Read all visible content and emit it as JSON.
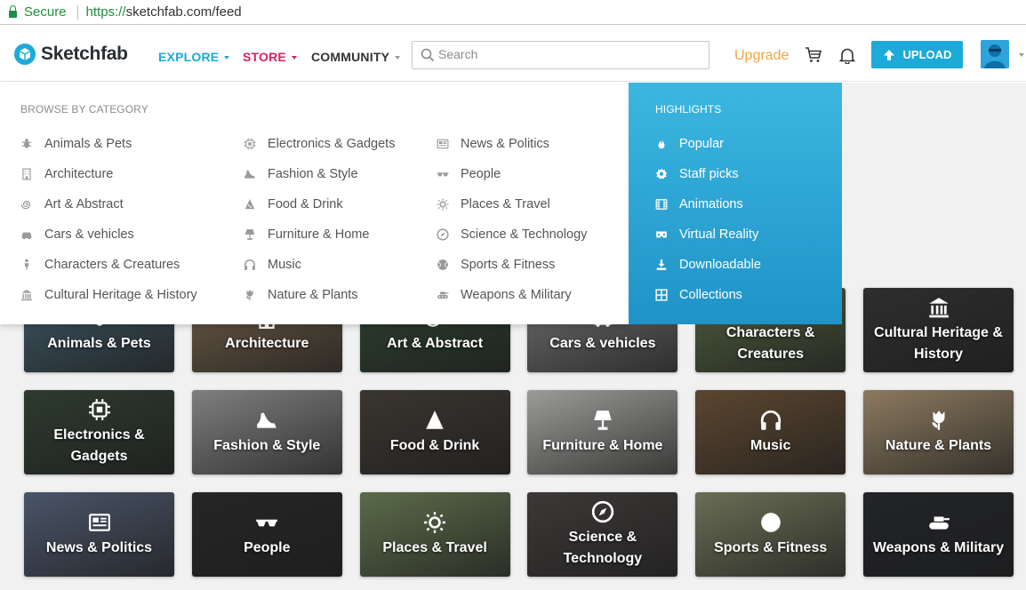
{
  "browser": {
    "secure_label": "Secure",
    "url_scheme": "https://",
    "url_rest": "sketchfab.com/feed"
  },
  "header": {
    "logo_text": "Sketchfab",
    "nav": [
      {
        "label": "EXPLORE",
        "color": "#1caad9"
      },
      {
        "label": "STORE",
        "color": "#d6245b"
      },
      {
        "label": "COMMUNITY",
        "color": "#333333"
      }
    ],
    "search_placeholder": "Search",
    "upgrade_label": "Upgrade",
    "upload_label": "UPLOAD"
  },
  "menu": {
    "heading": "BROWSE BY CATEGORY",
    "columns": [
      [
        {
          "label": "Animals & Pets",
          "icon": "bug-icon"
        },
        {
          "label": "Architecture",
          "icon": "building-icon"
        },
        {
          "label": "Art & Abstract",
          "icon": "spiral-icon"
        },
        {
          "label": "Cars & vehicles",
          "icon": "car-icon"
        },
        {
          "label": "Characters & Creatures",
          "icon": "figure-icon"
        },
        {
          "label": "Cultural Heritage & History",
          "icon": "temple-icon"
        }
      ],
      [
        {
          "label": "Electronics & Gadgets",
          "icon": "chip-icon"
        },
        {
          "label": "Fashion & Style",
          "icon": "heel-icon"
        },
        {
          "label": "Food & Drink",
          "icon": "pizza-icon"
        },
        {
          "label": "Furniture & Home",
          "icon": "lamp-icon"
        },
        {
          "label": "Music",
          "icon": "headphones-icon"
        },
        {
          "label": "Nature & Plants",
          "icon": "tulip-icon"
        }
      ],
      [
        {
          "label": "News & Politics",
          "icon": "newspaper-icon"
        },
        {
          "label": "People",
          "icon": "glasses-icon"
        },
        {
          "label": "Places & Travel",
          "icon": "sun-icon"
        },
        {
          "label": "Science & Technology",
          "icon": "compass-icon"
        },
        {
          "label": "Sports & Fitness",
          "icon": "ball-icon"
        },
        {
          "label": "Weapons & Military",
          "icon": "tank-icon"
        }
      ]
    ]
  },
  "highlights": {
    "heading": "HIGHLIGHTS",
    "items": [
      {
        "label": "Popular",
        "icon": "flame-icon"
      },
      {
        "label": "Staff picks",
        "icon": "badge-icon"
      },
      {
        "label": "Animations",
        "icon": "film-icon"
      },
      {
        "label": "Virtual Reality",
        "icon": "vr-icon"
      },
      {
        "label": "Downloadable",
        "icon": "download-icon"
      },
      {
        "label": "Collections",
        "icon": "grid-icon"
      }
    ]
  },
  "tiles": [
    {
      "label": "Animals & Pets",
      "bg": "#3d5560",
      "icon": "bug-icon"
    },
    {
      "label": "Architecture",
      "bg": "#6a5a45",
      "icon": "building-icon"
    },
    {
      "label": "Art & Abstract",
      "bg": "#2d4030",
      "icon": "spiral-icon"
    },
    {
      "label": "Cars & vehicles",
      "bg": "#6c6c6c",
      "icon": "car-icon"
    },
    {
      "label": "Characters & Creatures",
      "bg": "#4c5a3c",
      "icon": "figure-icon"
    },
    {
      "label": "Cultural Heritage & History",
      "bg": "#2e2e2e",
      "icon": "temple-icon"
    },
    {
      "label": "Electronics & Gadgets",
      "bg": "#2d3a2f",
      "icon": "chip-icon"
    },
    {
      "label": "Fashion & Style",
      "bg": "#7f7f7f",
      "icon": "heel-icon"
    },
    {
      "label": "Food & Drink",
      "bg": "#3a3530",
      "icon": "pizza-icon"
    },
    {
      "label": "Furniture & Home",
      "bg": "#9b9b98",
      "icon": "lamp-icon"
    },
    {
      "label": "Music",
      "bg": "#5b4630",
      "icon": "headphones-icon"
    },
    {
      "label": "Nature & Plants",
      "bg": "#8c7a60",
      "icon": "tulip-icon"
    },
    {
      "label": "News & Politics",
      "bg": "#4a5568",
      "icon": "newspaper-icon"
    },
    {
      "label": "People",
      "bg": "#262626",
      "icon": "glasses-icon"
    },
    {
      "label": "Places & Travel",
      "bg": "#5b6b4a",
      "icon": "sun-icon"
    },
    {
      "label": "Science & Technology",
      "bg": "#3d3838",
      "icon": "compass-icon"
    },
    {
      "label": "Sports & Fitness",
      "bg": "#6a6e55",
      "icon": "ball-icon"
    },
    {
      "label": "Weapons & Military",
      "bg": "#222428",
      "icon": "tank-icon"
    }
  ]
}
